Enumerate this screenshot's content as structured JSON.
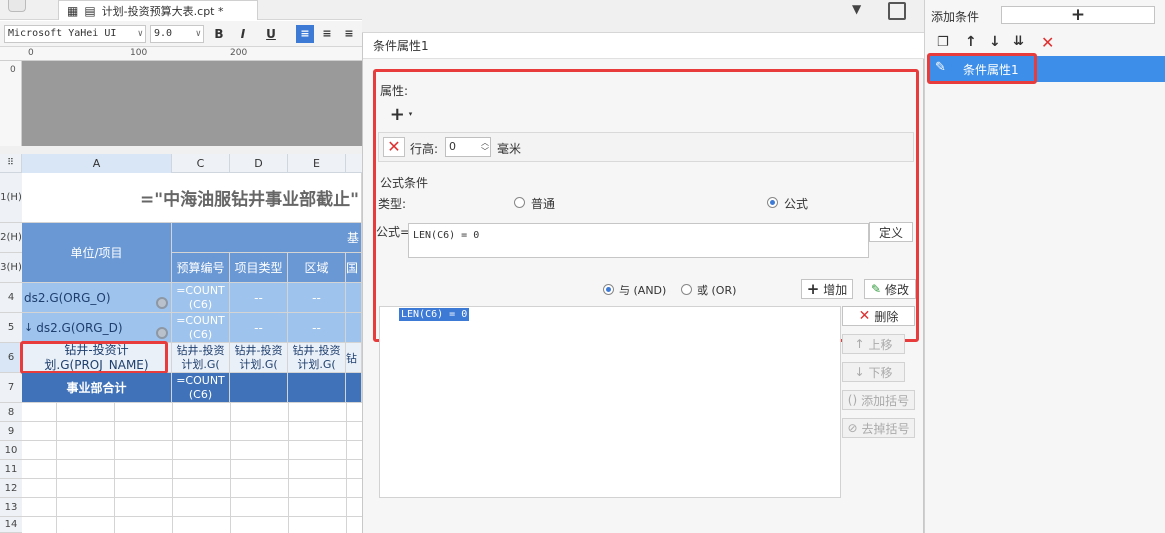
{
  "editor": {
    "tab_title": "计划-投资预算大表.cpt *",
    "font_name": "Microsoft YaHei UI",
    "font_size": "9.0",
    "bold": "B",
    "italic": "I",
    "underline": "U",
    "ruler": {
      "mark0": "0",
      "mark100": "100",
      "mark200": "200",
      "vmark": "0"
    }
  },
  "sheet": {
    "columns": [
      "A",
      "C",
      "D",
      "E"
    ],
    "rows": [
      {
        "num": "1(H)"
      },
      {
        "num": "2(H)"
      },
      {
        "num": "3(H)"
      },
      {
        "num": "4"
      },
      {
        "num": "5"
      },
      {
        "num": "6"
      },
      {
        "num": "7"
      },
      {
        "num": "8"
      },
      {
        "num": "9"
      },
      {
        "num": "10"
      },
      {
        "num": "11"
      },
      {
        "num": "12"
      },
      {
        "num": "13"
      },
      {
        "num": "14"
      }
    ],
    "title_cell": "=\"中海油服钻井事业部截止\"",
    "header_unit": "单位/项目",
    "header_top": "基",
    "headers": [
      "预算编号",
      "项目类型",
      "区域",
      "国"
    ],
    "row4_a": "ds2.G(ORG_O)",
    "row5_a": "ds2.G(ORG_D)",
    "count_formula": "=COUNT(C6)",
    "row4_dash": "--",
    "row6_a": "钻井-投资计划.G(PROJ_NAME)",
    "row6_other": "钻井-投资计划.G(",
    "row6_last": "钻",
    "row7_a": "事业部合计"
  },
  "dialog": {
    "title": "条件属性1",
    "section_attr": "属性:",
    "add_symbol": "+",
    "row_height_label": "行高:",
    "row_height_value": "0",
    "row_height_unit": "毫米",
    "section_formula": "公式条件",
    "type_label": "类型:",
    "type_normal": "普通",
    "type_formula": "公式",
    "formula_label": "公式=",
    "formula_value": "LEN(C6) = 0",
    "define_button": "定义",
    "and_label": "与 (AND)",
    "or_label": "或 (OR)",
    "add_button": "增加",
    "modify_button": "修改",
    "delete_button": "删除",
    "up_button": "上移",
    "down_button": "下移",
    "add_paren_button": "添加括号",
    "remove_paren_button": "去掉括号",
    "list_items": [
      "LEN(C6) = 0"
    ]
  },
  "conditions_panel": {
    "add_label": "添加条件",
    "add_symbol": "+",
    "items": [
      "条件属性1"
    ]
  },
  "colors": {
    "highlight_red": "#e83b3b",
    "selection_blue": "#3d8ee8",
    "header_blue": "#6a98d4",
    "total_blue": "#3f72b8"
  }
}
